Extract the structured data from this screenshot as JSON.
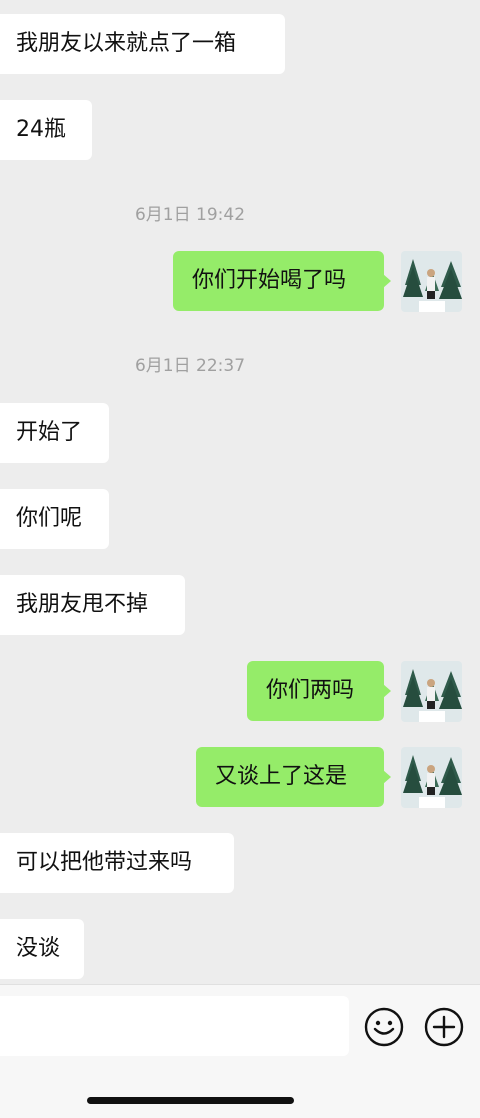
{
  "messages": [
    {
      "type": "in",
      "text": "我朋友以来就点了一箱"
    },
    {
      "type": "in",
      "text": "24瓶"
    },
    {
      "type": "time",
      "text": "6月1日 19:42"
    },
    {
      "type": "out",
      "text": "你们开始喝了吗"
    },
    {
      "type": "time",
      "text": "6月1日 22:37"
    },
    {
      "type": "in",
      "text": "开始了"
    },
    {
      "type": "in",
      "text": "你们呢"
    },
    {
      "type": "in",
      "text": "我朋友甩不掉"
    },
    {
      "type": "out",
      "text": "你们两吗"
    },
    {
      "type": "out",
      "text": "又谈上了这是"
    },
    {
      "type": "in",
      "text": "可以把他带过来吗"
    },
    {
      "type": "in",
      "text": "没谈"
    }
  ],
  "input": {
    "value": "",
    "placeholder": ""
  },
  "icons": {
    "emoji": "smiley-face-icon",
    "more": "plus-circle-icon"
  },
  "colors": {
    "background": "#ededed",
    "incoming_bubble": "#ffffff",
    "outgoing_bubble": "#95ec69",
    "timestamp": "#a0a0a0"
  }
}
